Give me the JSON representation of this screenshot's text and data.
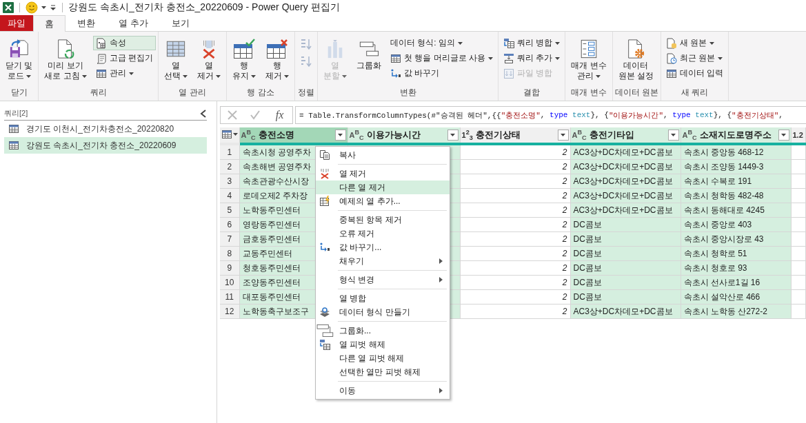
{
  "title_bar": {
    "title": "강원도 속초시_전기차 충전소_20220609 - Power Query 편집기"
  },
  "tabs": [
    {
      "label": "파일",
      "kind": "file",
      "selected": false
    },
    {
      "label": "홈",
      "kind": "tab",
      "selected": true
    },
    {
      "label": "변환",
      "kind": "tab",
      "selected": false
    },
    {
      "label": "열 추가",
      "kind": "tab",
      "selected": false
    },
    {
      "label": "보기",
      "kind": "tab",
      "selected": false
    }
  ],
  "ribbon": {
    "groups": [
      {
        "label": "닫기",
        "items": [
          {
            "kind": "large",
            "lines": [
              "닫기 및",
              "로드"
            ],
            "dropdown": true,
            "disabled": false,
            "on": false
          }
        ]
      },
      {
        "label": "쿼리",
        "items": [
          {
            "kind": "large",
            "lines": [
              "미리 보기",
              "새로 고침"
            ],
            "dropdown": true,
            "disabled": false,
            "on": false
          },
          {
            "kind": "small",
            "label": "속성",
            "dropdown": false,
            "disabled": false,
            "on": true
          },
          {
            "kind": "small",
            "label": "고급 편집기",
            "dropdown": false,
            "disabled": false,
            "on": false
          },
          {
            "kind": "small",
            "label": "관리",
            "dropdown": true,
            "disabled": false,
            "on": false
          }
        ]
      },
      {
        "label": "열 관리",
        "items": [
          {
            "kind": "large",
            "lines": [
              "열",
              "선택"
            ],
            "dropdown": true,
            "disabled": false,
            "on": false
          },
          {
            "kind": "large",
            "lines": [
              "열",
              "제거"
            ],
            "dropdown": true,
            "disabled": false,
            "on": false
          }
        ]
      },
      {
        "label": "행 감소",
        "items": [
          {
            "kind": "large",
            "lines": [
              "행",
              "유지"
            ],
            "dropdown": true,
            "disabled": false,
            "on": false
          },
          {
            "kind": "large",
            "lines": [
              "행",
              "제거"
            ],
            "dropdown": true,
            "disabled": false,
            "on": false
          }
        ]
      },
      {
        "label": "정렬",
        "items": [
          {
            "kind": "icon",
            "dropdown": false,
            "disabled": true,
            "on": false
          },
          {
            "kind": "icon",
            "dropdown": false,
            "disabled": true,
            "on": false
          }
        ]
      },
      {
        "label": "변환",
        "items": [
          {
            "kind": "large",
            "lines": [
              "열",
              "분할"
            ],
            "dropdown": true,
            "disabled": true,
            "on": false
          },
          {
            "kind": "large",
            "lines": [
              "그룹화"
            ],
            "dropdown": false,
            "disabled": false,
            "on": false
          },
          {
            "kind": "small",
            "label": "데이터 형식: 임의",
            "dropdown": true,
            "disabled": false,
            "on": false
          },
          {
            "kind": "small",
            "label": "첫 행을 머리글로 사용",
            "dropdown": true,
            "disabled": false,
            "on": false
          },
          {
            "kind": "small",
            "label": "값 바꾸기",
            "dropdown": false,
            "disabled": false,
            "on": false
          }
        ]
      },
      {
        "label": "결합",
        "items": [
          {
            "kind": "small",
            "label": "쿼리 병합",
            "dropdown": true,
            "disabled": false,
            "on": false
          },
          {
            "kind": "small",
            "label": "쿼리 추가",
            "dropdown": true,
            "disabled": false,
            "on": false
          },
          {
            "kind": "small",
            "label": "파일 병합",
            "dropdown": false,
            "disabled": true,
            "on": false
          }
        ]
      },
      {
        "label": "매개 변수",
        "items": [
          {
            "kind": "large",
            "lines": [
              "매개 변수",
              "관리"
            ],
            "dropdown": true,
            "disabled": false,
            "on": false
          }
        ]
      },
      {
        "label": "데이터 원본",
        "items": [
          {
            "kind": "large",
            "lines": [
              "데이터",
              "원본 설정"
            ],
            "dropdown": false,
            "disabled": false,
            "on": false
          }
        ]
      },
      {
        "label": "새 쿼리",
        "items": [
          {
            "kind": "small",
            "label": "새 원본",
            "dropdown": true,
            "disabled": false,
            "on": false
          },
          {
            "kind": "small",
            "label": "최근 원본",
            "dropdown": true,
            "disabled": false,
            "on": false
          },
          {
            "kind": "small",
            "label": "데이터 입력",
            "dropdown": false,
            "disabled": false,
            "on": false
          }
        ]
      }
    ]
  },
  "queries": {
    "header": "쿼리[2]",
    "items": [
      {
        "name": "경기도 이천시_전기차충전소_20220820",
        "selected": false
      },
      {
        "name": "강원도 속초시_전기차 충전소_20220609",
        "selected": true
      }
    ]
  },
  "formula_bar": {
    "function_label": "fx",
    "tokens": [
      {
        "text": "= Table.TransformColumnTypes(#\"승격된 헤더\",{{",
        "kind": "plain"
      },
      {
        "text": "\"충전소명\"",
        "kind": "string"
      },
      {
        "text": ", ",
        "kind": "plain"
      },
      {
        "text": "type",
        "kind": "keyword"
      },
      {
        "text": " text",
        "kind": "typename"
      },
      {
        "text": "}, {",
        "kind": "plain"
      },
      {
        "text": "\"이용가능시간\"",
        "kind": "string"
      },
      {
        "text": ", ",
        "kind": "plain"
      },
      {
        "text": "type",
        "kind": "keyword"
      },
      {
        "text": " text",
        "kind": "typename"
      },
      {
        "text": "}, {",
        "kind": "plain"
      },
      {
        "text": "\"충전기상태\"",
        "kind": "string"
      },
      {
        "text": ",",
        "kind": "plain"
      }
    ]
  },
  "table": {
    "columns": [
      {
        "type_badge": "A$^{B}$$_{C}$",
        "kind": "text",
        "name": "충전소명",
        "selected": true,
        "focused": true
      },
      {
        "type_badge": "A$^{B}$$_{C}$",
        "kind": "text",
        "name": "이용가능시간",
        "selected": true,
        "focused": false
      },
      {
        "type_badge": "1$^{2}$$_{3}$",
        "kind": "whole",
        "name": "충전기상태",
        "selected": false,
        "focused": false
      },
      {
        "type_badge": "A$^{B}$$_{C}$",
        "kind": "text",
        "name": "충전기타입",
        "selected": true,
        "focused": false
      },
      {
        "type_badge": "A$^{B}$$_{C}$",
        "kind": "text",
        "name": "소재지도로명주소",
        "selected": true,
        "focused": false
      },
      {
        "type_badge": "1.2",
        "kind": "decimal",
        "selected": false,
        "focused": false
      }
    ],
    "rows": [
      {
        "number": "1",
        "station": "속초시청 공영주차",
        "status": "2",
        "charger_type": "AC3상+DC차데모+DC콤보",
        "address": "속초시 중앙동 468-12"
      },
      {
        "number": "2",
        "station": "속초해변 공영주차",
        "status": "2",
        "charger_type": "AC3상+DC차데모+DC콤보",
        "address": "속초시 조양동 1449-3"
      },
      {
        "number": "3",
        "station": "속초관광수산시장",
        "status": "2",
        "charger_type": "AC3상+DC차데모+DC콤보",
        "address": "속초시 수복로 191"
      },
      {
        "number": "4",
        "station": "로데오제2 주차장",
        "status": "2",
        "charger_type": "AC3상+DC차데모+DC콤보",
        "address": "속초시 청학동 482-48"
      },
      {
        "number": "5",
        "station": "노학동주민센터",
        "status": "2",
        "charger_type": "AC3상+DC차데모+DC콤보",
        "address": "속초시 동해대로 4245"
      },
      {
        "number": "6",
        "station": "영랑동주민센터",
        "status": "2",
        "charger_type": "DC콤보",
        "address": "속초시 중앙로 403"
      },
      {
        "number": "7",
        "station": "금호동주민센터",
        "status": "2",
        "charger_type": "DC콤보",
        "address": "속초시 중앙시장로 43"
      },
      {
        "number": "8",
        "station": "교동주민센터",
        "status": "2",
        "charger_type": "DC콤보",
        "address": "속초시 청학로 51"
      },
      {
        "number": "9",
        "station": "청호동주민센터",
        "status": "2",
        "charger_type": "DC콤보",
        "address": "속초시 청호로 93"
      },
      {
        "number": "10",
        "station": "조양동주민센터",
        "status": "2",
        "charger_type": "DC콤보",
        "address": "속초시 선사로1길 16"
      },
      {
        "number": "11",
        "station": "대포동주민센터",
        "status": "2",
        "charger_type": "DC콤보",
        "address": "속초시 설악산로 466"
      },
      {
        "number": "12",
        "station": "노학동축구보조구",
        "status": "2",
        "charger_type": "AC3상+DC차데모+DC콤보",
        "address": "속초시 노학동 산272-2"
      }
    ]
  },
  "context_menu": {
    "sections": [
      [
        {
          "label": "복사",
          "submenu": false,
          "selected": false
        }
      ],
      [
        {
          "label": "열 제거",
          "submenu": false,
          "selected": false
        },
        {
          "label": "다른 열 제거",
          "submenu": false,
          "selected": true
        },
        {
          "label": "예제의 열 추가...",
          "submenu": false,
          "selected": false
        }
      ],
      [
        {
          "label": "중복된 항목 제거",
          "submenu": false,
          "selected": false
        },
        {
          "label": "오류 제거",
          "submenu": false,
          "selected": false
        },
        {
          "label": "값 바꾸기...",
          "submenu": false,
          "selected": false
        },
        {
          "label": "채우기",
          "submenu": true,
          "selected": false
        }
      ],
      [
        {
          "label": "형식 변경",
          "submenu": true,
          "selected": false
        }
      ],
      [
        {
          "label": "열 병합",
          "submenu": false,
          "selected": false
        },
        {
          "label": "데이터 형식 만들기",
          "submenu": false,
          "selected": false
        }
      ],
      [
        {
          "label": "그룹화...",
          "submenu": false,
          "selected": false
        },
        {
          "label": "열 피벗 해제",
          "submenu": false,
          "selected": false
        },
        {
          "label": "다른 열 피벗 해제",
          "submenu": false,
          "selected": false
        },
        {
          "label": "선택한 열만 피벗 해제",
          "submenu": false,
          "selected": false
        }
      ],
      [
        {
          "label": "이동",
          "submenu": true,
          "selected": false
        }
      ]
    ]
  }
}
